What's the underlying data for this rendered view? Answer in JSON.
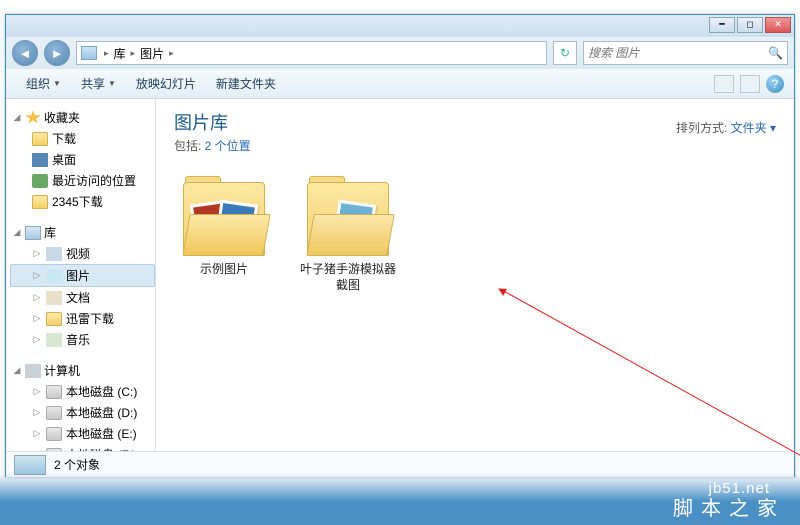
{
  "breadcrumb": {
    "seg1": "库",
    "seg2": "图片"
  },
  "search": {
    "placeholder": "搜索 图片"
  },
  "toolbar": {
    "organize": "组织",
    "share": "共享",
    "slideshow": "放映幻灯片",
    "newfolder": "新建文件夹"
  },
  "sidebar": {
    "favorites": "收藏夹",
    "fav_items": {
      "download": "下载",
      "desktop": "桌面",
      "recent": "最近访问的位置",
      "d2345": "2345下载"
    },
    "libraries": "库",
    "lib_items": {
      "video": "视频",
      "pictures": "图片",
      "documents": "文档",
      "xunlei": "迅雷下载",
      "music": "音乐"
    },
    "computer": "计算机",
    "drives": {
      "c": "本地磁盘 (C:)",
      "d": "本地磁盘 (D:)",
      "e": "本地磁盘 (E:)",
      "f": "本地磁盘 (F:)"
    }
  },
  "content": {
    "title": "图片库",
    "subtitle_prefix": "包括: ",
    "subtitle_link": "2 个位置",
    "sort_label": "排列方式:",
    "sort_value": "文件夹",
    "items": {
      "sample": "示例图片",
      "yezizhu": "叶子猪手游模拟器截图"
    }
  },
  "statusbar": {
    "count": "2 个对象"
  },
  "watermark": {
    "url": "jb51.net",
    "text": "脚本之家"
  }
}
